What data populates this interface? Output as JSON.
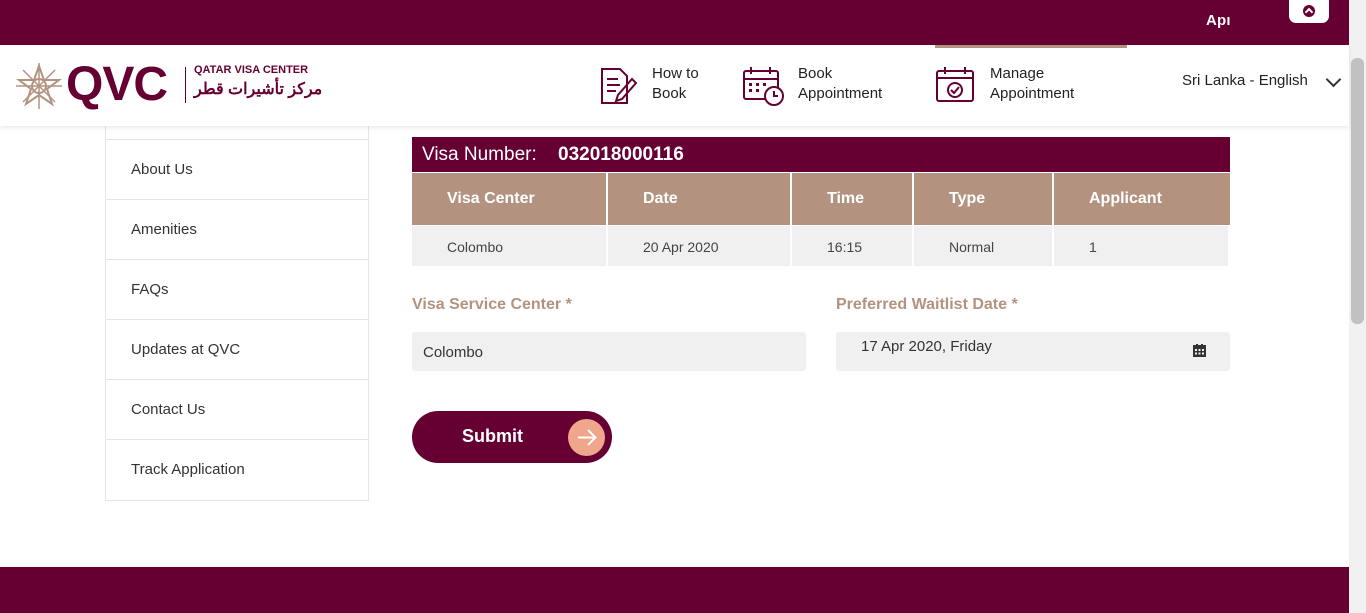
{
  "topbar": {
    "text": "Apı"
  },
  "brand": {
    "short": "QVC",
    "name_en": "QATAR VISA CENTER",
    "name_ar": "مركز تأشيرات قطر",
    "color": "#660032",
    "accent": "#b39380"
  },
  "nav": [
    {
      "label": "How to\nBook",
      "icon": "document-pen-icon"
    },
    {
      "label": "Book\nAppointment",
      "icon": "calendar-clock-icon"
    },
    {
      "label": "Manage\nAppointment",
      "icon": "calendar-check-icon",
      "active": true
    }
  ],
  "language": {
    "selected": "Sri Lanka - English"
  },
  "sidebar": {
    "items": [
      {
        "label": "About Us"
      },
      {
        "label": "Amenities"
      },
      {
        "label": "FAQs"
      },
      {
        "label": "Updates at QVC"
      },
      {
        "label": "Contact Us"
      },
      {
        "label": "Track Application"
      }
    ]
  },
  "visa": {
    "label": "Visa Number:",
    "number": "032018000116"
  },
  "table": {
    "headers": [
      "Visa Center",
      "Date",
      "Time",
      "Type",
      "Applicant"
    ],
    "rows": [
      [
        "Colombo",
        "20 Apr 2020",
        "16:15",
        "Normal",
        "1"
      ]
    ]
  },
  "form": {
    "service_center": {
      "label": "Visa Service Center *",
      "value": "Colombo"
    },
    "waitlist_date": {
      "label": "Preferred Waitlist Date *",
      "value": "17 Apr 2020, Friday"
    }
  },
  "submit": {
    "label": "Submit"
  }
}
